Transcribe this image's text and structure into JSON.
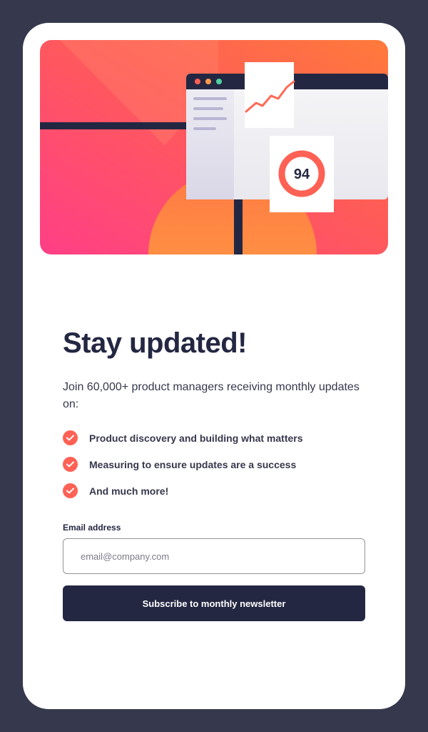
{
  "hero": {
    "score": "94",
    "colors": {
      "coral": "#ff6155",
      "pink": "#ff527b",
      "orange": "#ff6a3a",
      "navy": "#242742"
    }
  },
  "signup": {
    "title": "Stay updated!",
    "intro": "Join 60,000+ product managers receiving monthly updates on:",
    "features": [
      {
        "label": "Product discovery and building what matters",
        "icon": "check-icon"
      },
      {
        "label": "Measuring to ensure updates are a success",
        "icon": "check-icon"
      },
      {
        "label": "And much more!",
        "icon": "check-icon"
      }
    ],
    "email_label": "Email address",
    "email_placeholder": "email@company.com",
    "email_value": "",
    "subscribe_label": "Subscribe to monthly newsletter"
  }
}
